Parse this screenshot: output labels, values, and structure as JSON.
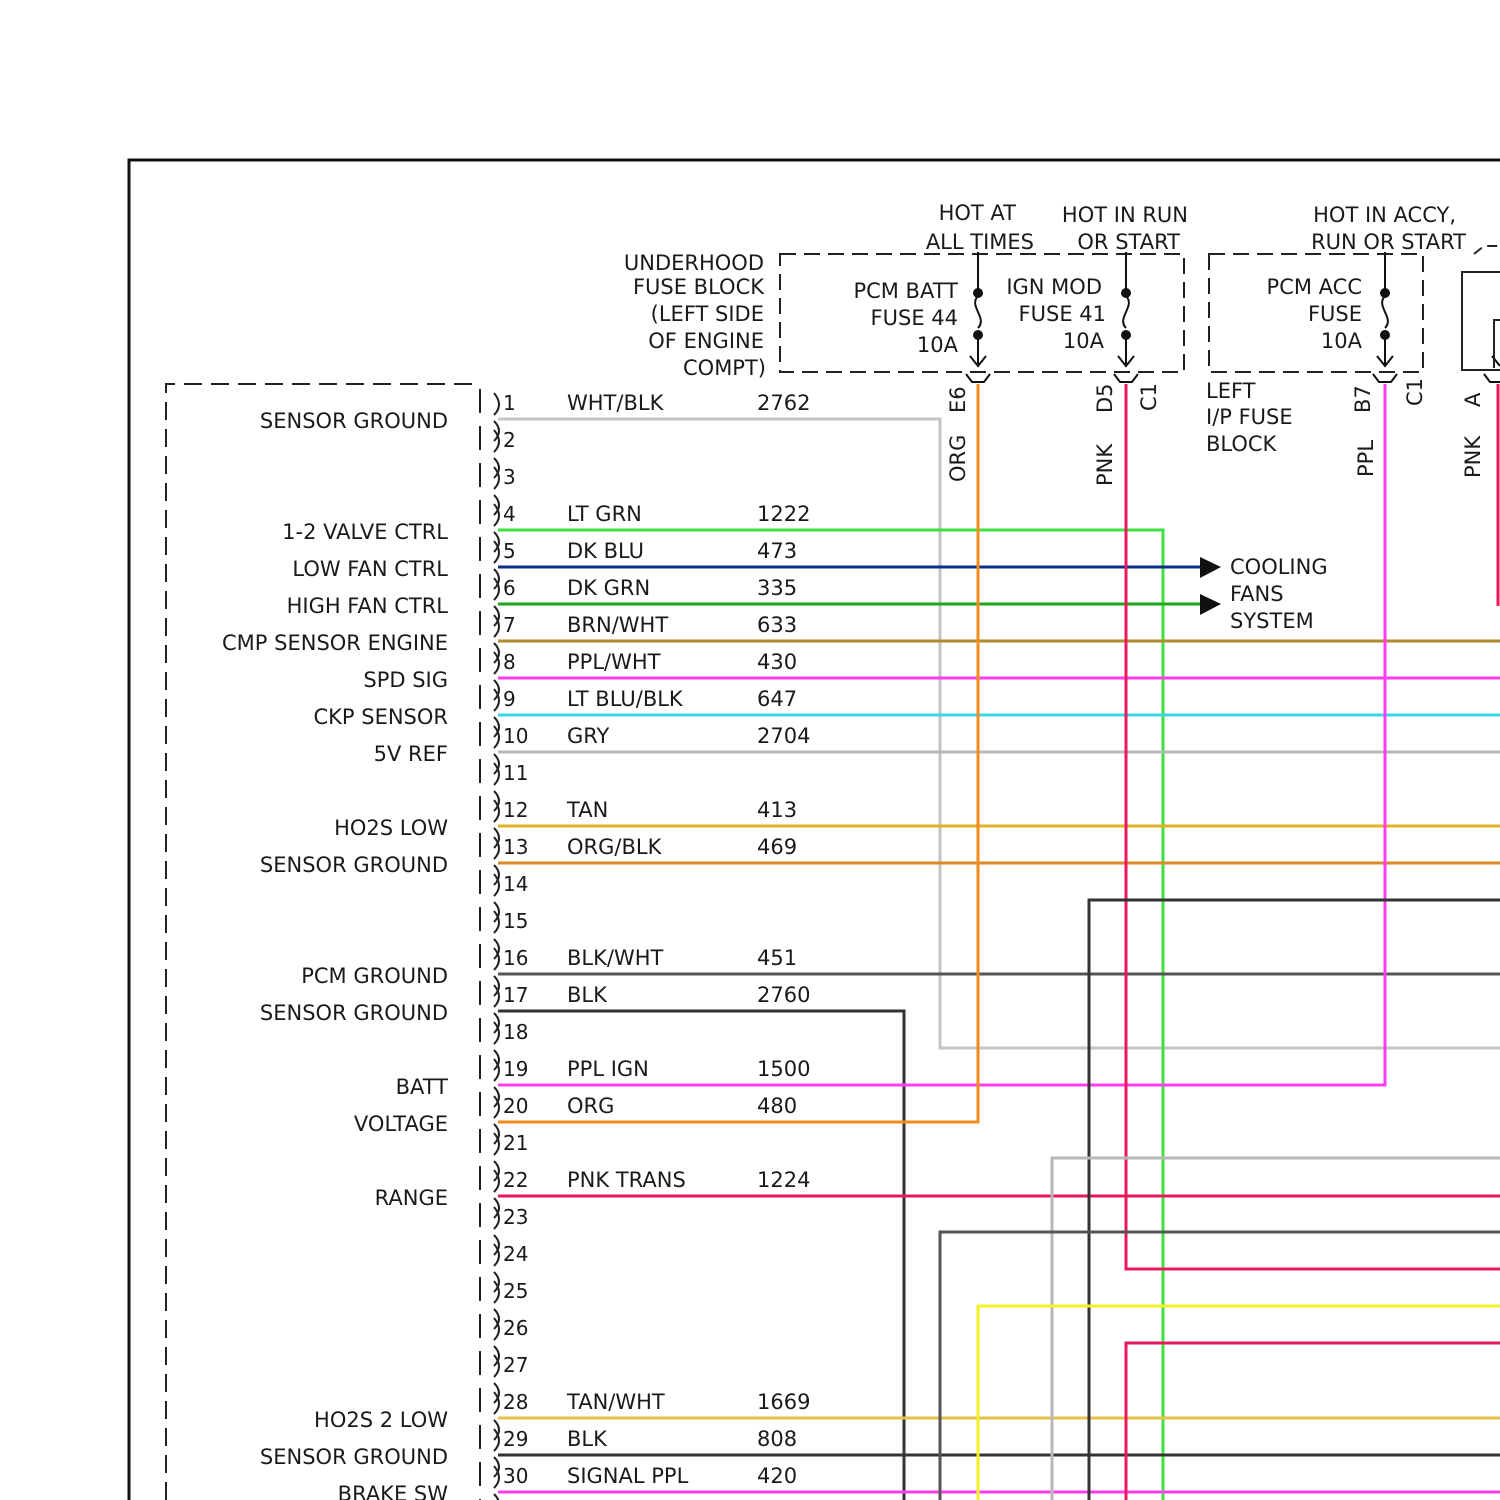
{
  "fuse_blocks": {
    "underhood": {
      "label_lines": [
        "UNDERHOOD",
        "FUSE BLOCK",
        "(LEFT SIDE",
        "OF ENGINE",
        "COMPT)"
      ],
      "hot_at_all_times": [
        "HOT AT",
        "ALL TIMES"
      ],
      "hot_in_run": [
        "HOT IN RUN",
        "OR START"
      ],
      "pcm_batt_fuse": [
        "PCM BATT",
        "FUSE 44",
        "10A"
      ],
      "ign_mod_fuse": [
        "IGN MOD",
        "FUSE 41",
        "10A"
      ]
    },
    "left_ip": {
      "label_lines": [
        "LEFT",
        "I/P FUSE",
        "BLOCK"
      ],
      "hot_in_accy": [
        "HOT IN ACCY,",
        "RUN OR START"
      ],
      "pcm_acc_fuse": [
        "PCM ACC",
        "FUSE",
        "10A"
      ]
    }
  },
  "connectors": {
    "e6": "E6",
    "d5": "D5",
    "c1a": "C1",
    "b7": "B7",
    "c1b": "C1",
    "a": "A"
  },
  "vertical_wires": {
    "org": "ORG",
    "pnk": "PNK",
    "ppl": "PPL",
    "pnk_right": "PNK"
  },
  "cooling_fans": [
    "COOLING",
    "FANS",
    "SYSTEM"
  ],
  "pcm_functions": [
    {
      "text": "SENSOR GROUND",
      "pin": 1
    },
    {
      "text": "1-2 VALVE CTRL",
      "pin": 4
    },
    {
      "text": "LOW FAN CTRL",
      "pin": 5
    },
    {
      "text": "HIGH FAN CTRL",
      "pin": 6
    },
    {
      "text": "CMP SENSOR ENGINE",
      "pin": 7
    },
    {
      "text": "SPD SIG",
      "pin": 8
    },
    {
      "text": "CKP SENSOR",
      "pin": 9
    },
    {
      "text": "5V REF",
      "pin": 10
    },
    {
      "text": "HO2S LOW",
      "pin": 12
    },
    {
      "text": "SENSOR GROUND",
      "pin": 13
    },
    {
      "text": "PCM GROUND",
      "pin": 16
    },
    {
      "text": "SENSOR GROUND",
      "pin": 17
    },
    {
      "text": "BATT",
      "pin": 19
    },
    {
      "text": "VOLTAGE",
      "pin": 20
    },
    {
      "text": "RANGE",
      "pin": 22
    },
    {
      "text": "HO2S 2 LOW",
      "pin": 28
    },
    {
      "text": "SENSOR GROUND",
      "pin": 29
    },
    {
      "text": "BRAKE SW",
      "pin": 30
    }
  ],
  "pins": [
    {
      "pin": "1",
      "wire": "WHT/BLK",
      "circuit": "2762",
      "color": "#c4c4c4"
    },
    {
      "pin": "2",
      "wire": "",
      "circuit": "",
      "color": ""
    },
    {
      "pin": "3",
      "wire": "",
      "circuit": "",
      "color": ""
    },
    {
      "pin": "4",
      "wire": "LT GRN",
      "circuit": "1222",
      "color": "#3ee23e"
    },
    {
      "pin": "5",
      "wire": "DK BLU",
      "circuit": "473",
      "color": "#0b2e8a"
    },
    {
      "pin": "6",
      "wire": "DK GRN",
      "circuit": "335",
      "color": "#1ea51e"
    },
    {
      "pin": "7",
      "wire": "BRN/WHT",
      "circuit": "633",
      "color": "#b08a2e"
    },
    {
      "pin": "8",
      "wire": "PPL/WHT",
      "circuit": "430",
      "color": "#ff3cf0"
    },
    {
      "pin": "9",
      "wire": "LT BLU/BLK",
      "circuit": "647",
      "color": "#3ad6e6"
    },
    {
      "pin": "10",
      "wire": "GRY",
      "circuit": "2704",
      "color": "#b8b8b8"
    },
    {
      "pin": "11",
      "wire": "",
      "circuit": "",
      "color": ""
    },
    {
      "pin": "12",
      "wire": "TAN",
      "circuit": "413",
      "color": "#e0b226"
    },
    {
      "pin": "13",
      "wire": "ORG/BLK",
      "circuit": "469",
      "color": "#d98a2a"
    },
    {
      "pin": "14",
      "wire": "",
      "circuit": "",
      "color": ""
    },
    {
      "pin": "15",
      "wire": "",
      "circuit": "",
      "color": ""
    },
    {
      "pin": "16",
      "wire": "BLK/WHT",
      "circuit": "451",
      "color": "#555555"
    },
    {
      "pin": "17",
      "wire": "BLK",
      "circuit": "2760",
      "color": "#333333"
    },
    {
      "pin": "18",
      "wire": "",
      "circuit": "",
      "color": ""
    },
    {
      "pin": "19",
      "wire": "PPL IGN",
      "circuit": "1500",
      "color": "#ff3cf0"
    },
    {
      "pin": "20",
      "wire": "ORG",
      "circuit": "480",
      "color": "#f08c1c"
    },
    {
      "pin": "21",
      "wire": "",
      "circuit": "",
      "color": ""
    },
    {
      "pin": "22",
      "wire": "PNK TRANS",
      "circuit": "1224",
      "color": "#e8185a"
    },
    {
      "pin": "23",
      "wire": "",
      "circuit": "",
      "color": ""
    },
    {
      "pin": "24",
      "wire": "",
      "circuit": "",
      "color": ""
    },
    {
      "pin": "25",
      "wire": "",
      "circuit": "",
      "color": ""
    },
    {
      "pin": "26",
      "wire": "",
      "circuit": "",
      "color": ""
    },
    {
      "pin": "27",
      "wire": "",
      "circuit": "",
      "color": ""
    },
    {
      "pin": "28",
      "wire": "TAN/WHT",
      "circuit": "1669",
      "color": "#e6c04a"
    },
    {
      "pin": "29",
      "wire": "BLK",
      "circuit": "808",
      "color": "#333333"
    },
    {
      "pin": "30",
      "wire": "SIGNAL PPL",
      "circuit": "420",
      "color": "#ff3cf0"
    }
  ],
  "colors": {
    "orange": "#f08c1c",
    "pink": "#e8185a",
    "purple": "#ff3cf0",
    "lt_green": "#3ee23e",
    "yellow": "#f2f226",
    "gray": "#b8b8b8",
    "black": "#333333"
  }
}
